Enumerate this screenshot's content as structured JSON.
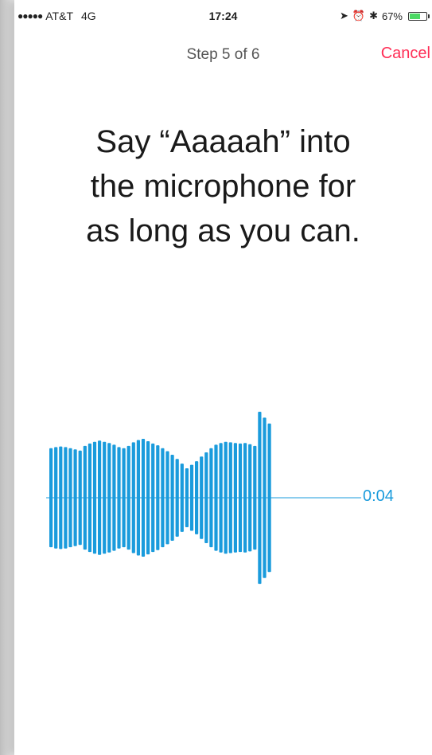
{
  "status_bar": {
    "carrier": "AT&T",
    "network": "4G",
    "time": "17:24",
    "battery_percent": "67%",
    "battery_level": 0.67
  },
  "nav": {
    "step": "Step 5 of 6",
    "cancel_label": "Cancel"
  },
  "instruction": {
    "line1": "Say “Aaaaah” into",
    "line2": "the microphone for",
    "line3": "as long as you can."
  },
  "recorder": {
    "elapsed": "0:04",
    "color": "#1a9bdc",
    "amplitudes": [
      0.84,
      0.86,
      0.87,
      0.86,
      0.84,
      0.82,
      0.8,
      0.88,
      0.92,
      0.95,
      0.97,
      0.95,
      0.93,
      0.9,
      0.86,
      0.84,
      0.88,
      0.94,
      0.98,
      1.0,
      0.96,
      0.92,
      0.89,
      0.84,
      0.79,
      0.73,
      0.66,
      0.58,
      0.5,
      0.56,
      0.62,
      0.7,
      0.77,
      0.84,
      0.9,
      0.93,
      0.95,
      0.94,
      0.93,
      0.92,
      0.93,
      0.91,
      0.88,
      1.46,
      1.36,
      1.26
    ]
  }
}
